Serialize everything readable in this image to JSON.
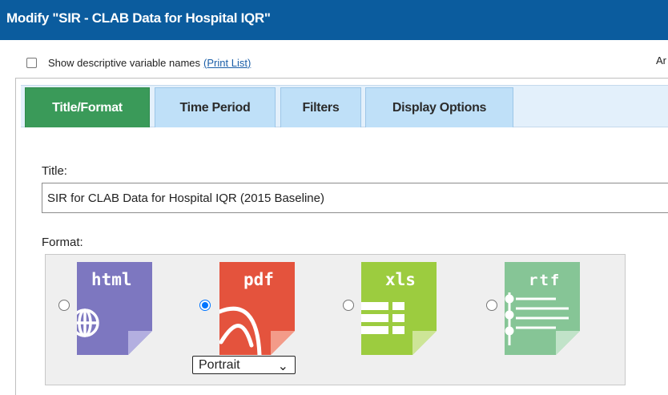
{
  "window": {
    "title": "Modify \"SIR - CLAB Data for Hospital IQR\""
  },
  "options": {
    "show_descriptive_label": "Show descriptive variable names",
    "print_list_link": "(Print List)",
    "right_cut_text": "Ar"
  },
  "tabs": [
    {
      "label": "Title/Format",
      "active": true
    },
    {
      "label": "Time Period",
      "active": false
    },
    {
      "label": "Filters",
      "active": false
    },
    {
      "label": "Display Options",
      "active": false
    }
  ],
  "title_field": {
    "label": "Title:",
    "value": "SIR for CLAB Data for Hospital IQR (2015 Baseline)"
  },
  "format": {
    "label": "Format:",
    "options": [
      {
        "label": "html",
        "color": "#7d77c0",
        "icon": "html-globe-icon",
        "selected": false
      },
      {
        "label": "pdf",
        "color": "#e4533d",
        "icon": "pdf-acrobat-icon",
        "selected": true
      },
      {
        "label": "xls",
        "color": "#9ccc3f",
        "icon": "xls-grid-icon",
        "selected": false
      },
      {
        "label": "rtf",
        "color": "#86c596",
        "icon": "rtf-lines-icon",
        "selected": false
      }
    ],
    "orientation": {
      "selected": "Portrait",
      "chevron": "⌄"
    }
  },
  "colors": {
    "title_bar": "#0b5c9e",
    "active_tab": "#3a9a59",
    "inactive_tab": "#bfe0f8",
    "link": "#1a5ea8"
  }
}
